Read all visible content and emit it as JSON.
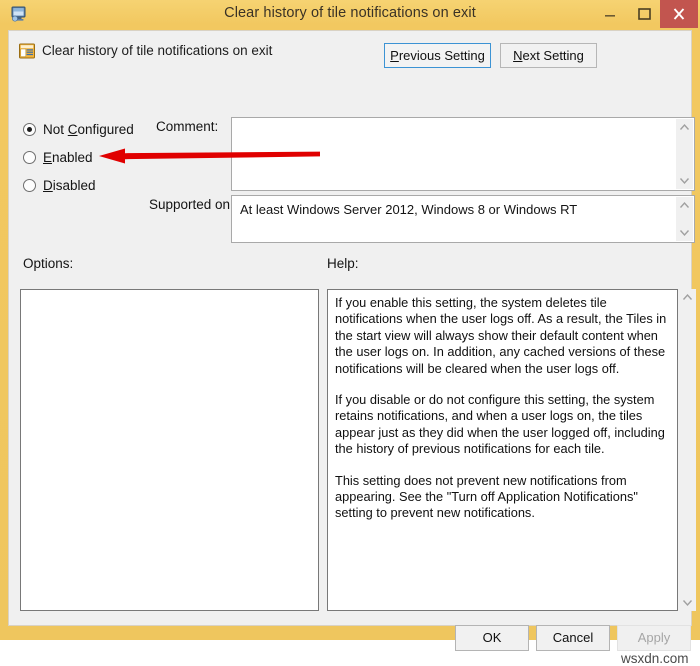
{
  "window": {
    "title": "Clear history of tile notifications on exit",
    "icon": "computer-monitor-icon",
    "caption_buttons": {
      "minimize": "minimize-icon",
      "maximize": "maximize-icon",
      "close": "close-icon"
    },
    "accent_titlebar": "#f2c860",
    "accent_close": "#c2554f"
  },
  "header": {
    "icon": "policy-setting-icon",
    "title": "Clear history of tile notifications on exit",
    "previous_button": {
      "accel": "P",
      "rest": "revious Setting",
      "focused": true
    },
    "next_button": {
      "accel": "N",
      "rest": "ext Setting",
      "focused": false
    }
  },
  "state_options": [
    {
      "id": "not-configured",
      "accel_before": "Not ",
      "accel": "C",
      "accel_after": "onfigured",
      "selected": true
    },
    {
      "id": "enabled",
      "accel_before": "",
      "accel": "E",
      "accel_after": "nabled",
      "selected": false
    },
    {
      "id": "disabled",
      "accel_before": "",
      "accel": "D",
      "accel_after": "isabled",
      "selected": false
    }
  ],
  "comment": {
    "label": "Comment:",
    "value": ""
  },
  "supported_on": {
    "label": "Supported on:",
    "value": "At least Windows Server 2012, Windows 8 or Windows RT"
  },
  "options": {
    "label": "Options:",
    "value": ""
  },
  "help": {
    "label": "Help:",
    "paragraphs": [
      "If you enable this setting, the system deletes tile notifications when the user logs off. As a result, the Tiles in the start view will always show their default content when the user logs on. In addition, any cached versions of these notifications will be cleared when the user logs off.",
      "If you disable or do not configure this setting, the system retains notifications, and when a user logs on, the tiles appear just as they did when the user logged off, including the history of previous notifications for each tile.",
      "This setting does not prevent new notifications from appearing. See the \"Turn off Application Notifications\" setting to prevent new notifications."
    ]
  },
  "footer": {
    "ok": "OK",
    "cancel": "Cancel",
    "apply": "Apply",
    "apply_disabled": true
  },
  "annotation": {
    "type": "red-arrow",
    "color": "#e00000",
    "points_to": "enabled"
  },
  "watermark": "wsxdn.com"
}
